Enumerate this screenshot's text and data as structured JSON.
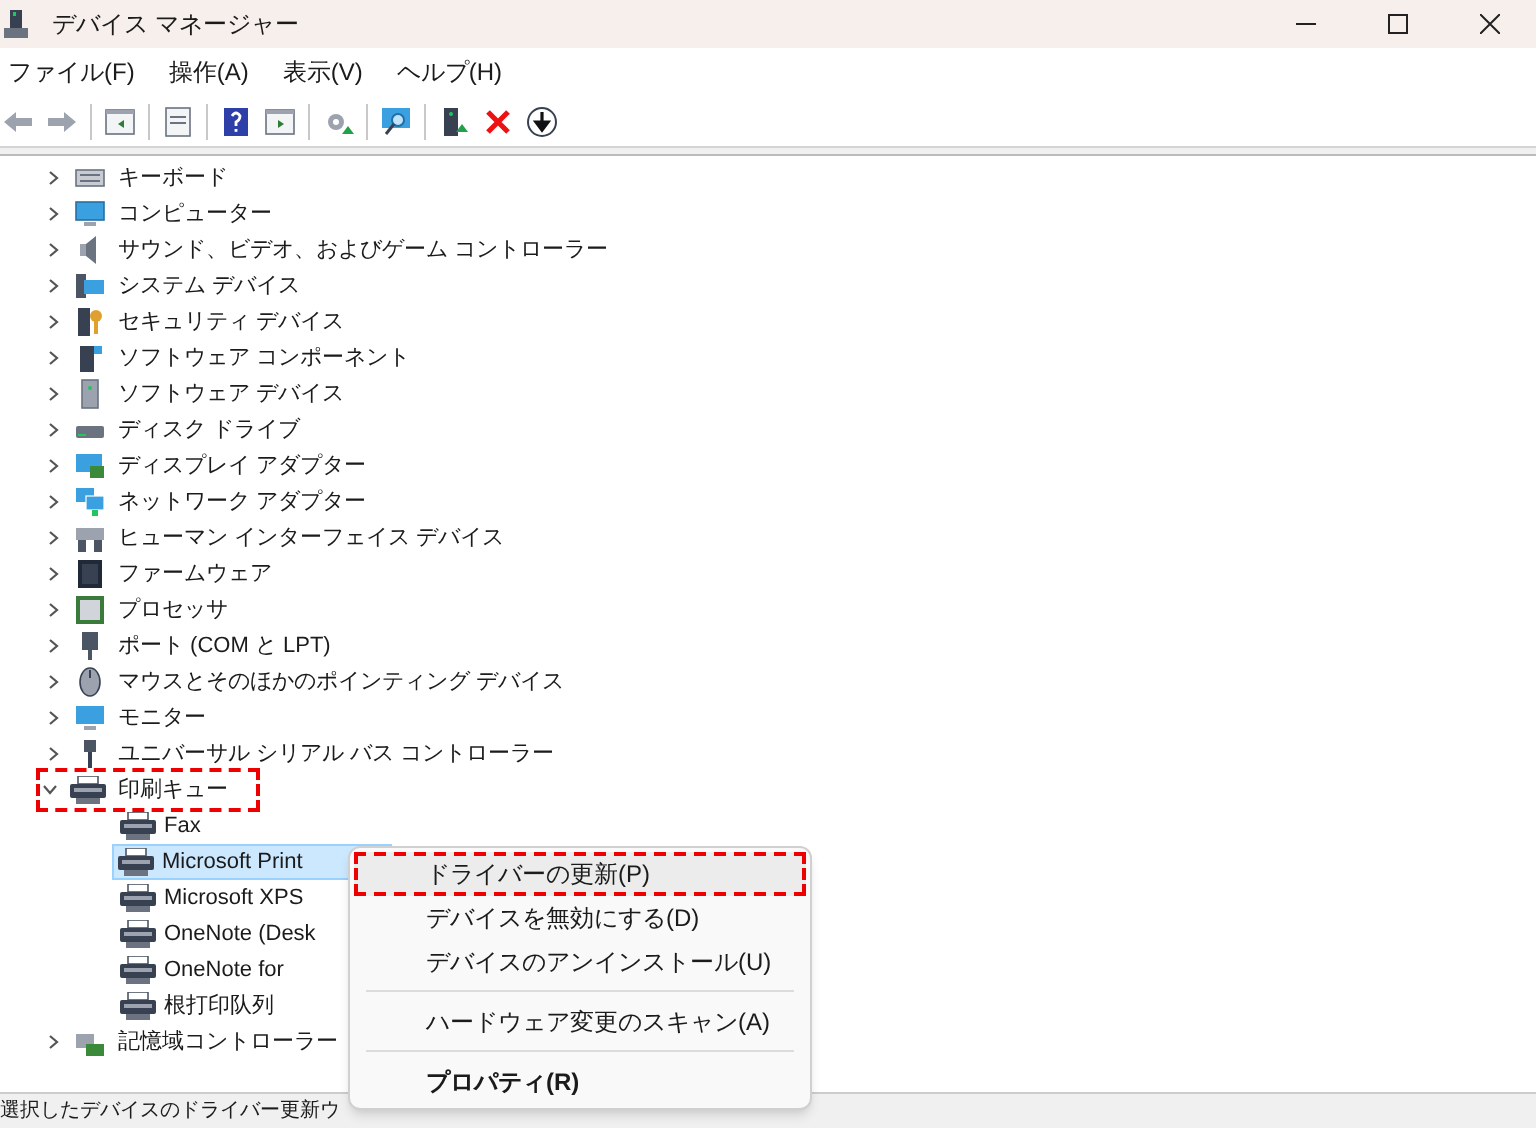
{
  "window": {
    "title": "デバイス マネージャー"
  },
  "menu_bar": [
    "ファイル(F)",
    "操作(A)",
    "表示(V)",
    "ヘルプ(H)"
  ],
  "tree": [
    {
      "label": "キーボード",
      "expanded": false,
      "annotated": false
    },
    {
      "label": "コンピューター",
      "expanded": false,
      "annotated": false
    },
    {
      "label": "サウンド、ビデオ、およびゲーム コントローラー",
      "expanded": false,
      "annotated": false
    },
    {
      "label": "システム デバイス",
      "expanded": false,
      "annotated": false
    },
    {
      "label": "セキュリティ デバイス",
      "expanded": false,
      "annotated": false
    },
    {
      "label": "ソフトウェア コンポーネント",
      "expanded": false,
      "annotated": false
    },
    {
      "label": "ソフトウェア デバイス",
      "expanded": false,
      "annotated": false
    },
    {
      "label": "ディスク ドライブ",
      "expanded": false,
      "annotated": false
    },
    {
      "label": "ディスプレイ アダプター",
      "expanded": false,
      "annotated": false
    },
    {
      "label": "ネットワーク アダプター",
      "expanded": false,
      "annotated": false
    },
    {
      "label": "ヒューマン インターフェイス デバイス",
      "expanded": false,
      "annotated": false
    },
    {
      "label": "ファームウェア",
      "expanded": false,
      "annotated": false
    },
    {
      "label": "プロセッサ",
      "expanded": false,
      "annotated": false
    },
    {
      "label": "ポート (COM と LPT)",
      "expanded": false,
      "annotated": false
    },
    {
      "label": "マウスとそのほかのポインティング デバイス",
      "expanded": false,
      "annotated": false
    },
    {
      "label": "モニター",
      "expanded": false,
      "annotated": false
    },
    {
      "label": "ユニバーサル シリアル バス コントローラー",
      "expanded": false,
      "annotated": false
    },
    {
      "label": "印刷キュー",
      "expanded": true,
      "annotated": true,
      "children": [
        {
          "label": "Fax",
          "selected": false
        },
        {
          "label": "Microsoft Print",
          "selected": true
        },
        {
          "label": "Microsoft XPS",
          "selected": false
        },
        {
          "label": "OneNote (Desk",
          "selected": false
        },
        {
          "label": "OneNote for",
          "selected": false
        },
        {
          "label": "根打印队列",
          "selected": false
        }
      ]
    },
    {
      "label": "記憶域コントローラー",
      "expanded": false,
      "annotated": false
    }
  ],
  "context_menu": {
    "groups": [
      [
        {
          "label": "ドライバーの更新(P)",
          "annotated": true,
          "bold": false
        },
        {
          "label": "デバイスを無効にする(D)",
          "annotated": false,
          "bold": false
        },
        {
          "label": "デバイスのアンインストール(U)",
          "annotated": false,
          "bold": false
        }
      ],
      [
        {
          "label": "ハードウェア変更のスキャン(A)",
          "annotated": false,
          "bold": false
        }
      ],
      [
        {
          "label": "プロパティ(R)",
          "annotated": false,
          "bold": true
        }
      ]
    ]
  },
  "status_bar": "選択したデバイスのドライバー更新ウ"
}
